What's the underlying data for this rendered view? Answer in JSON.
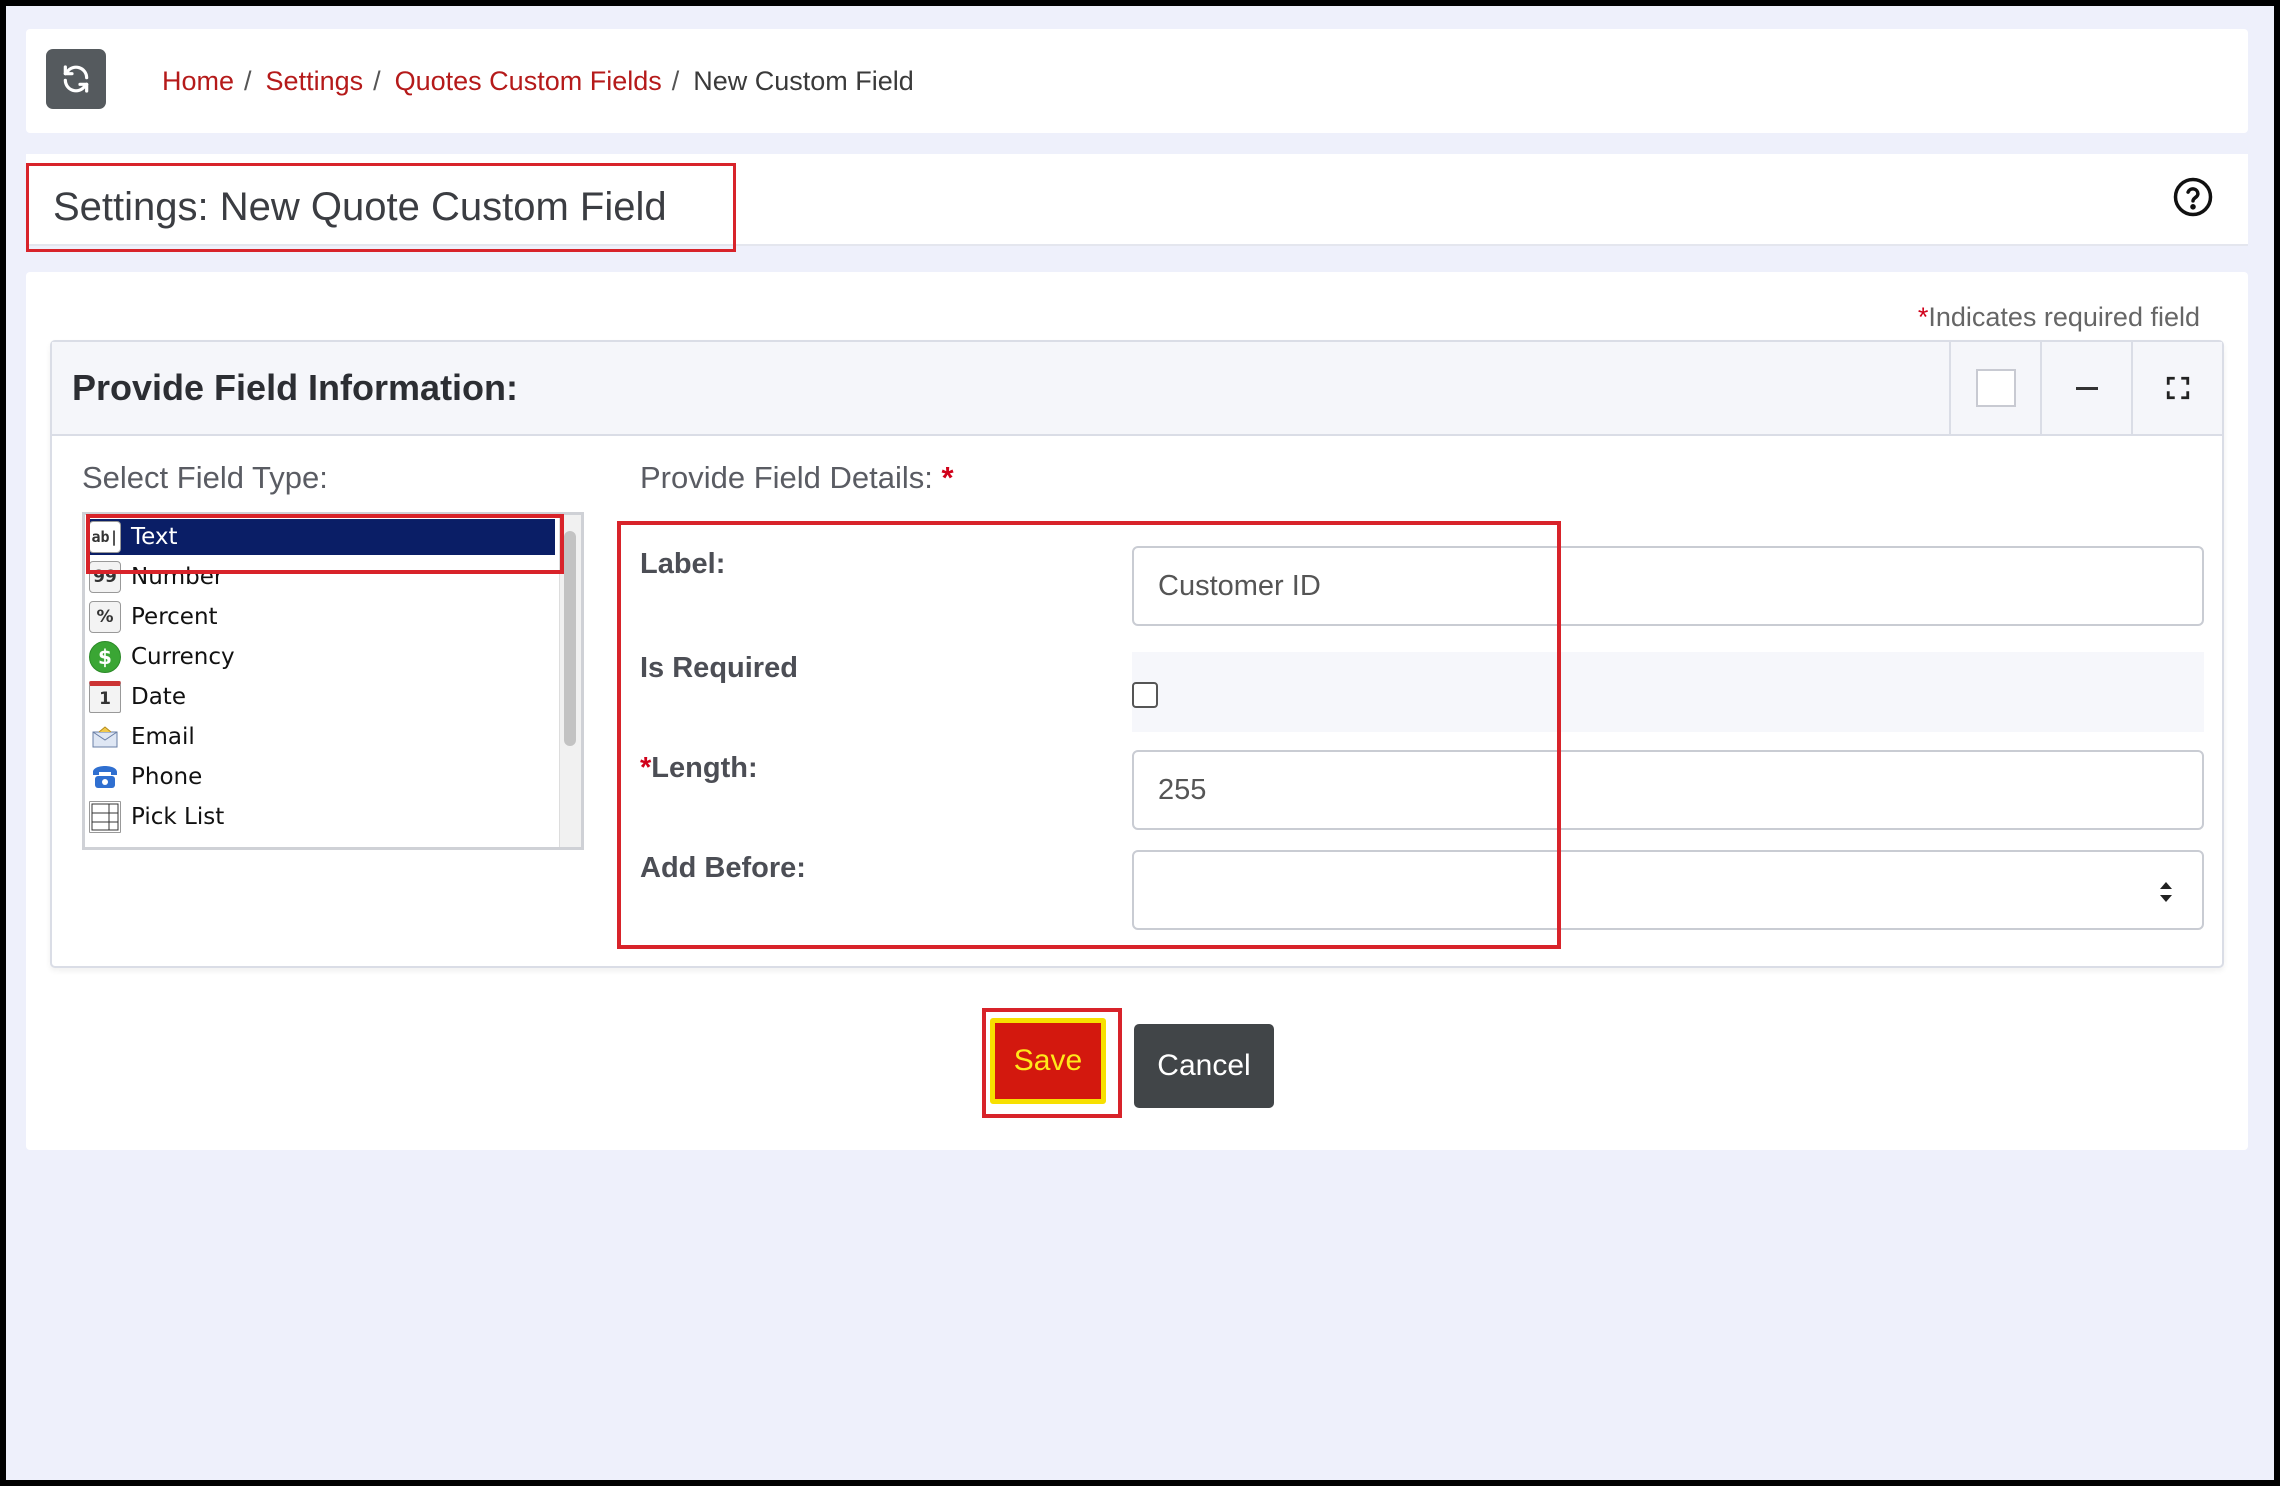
{
  "breadcrumb": {
    "refresh_icon": "refresh-icon",
    "items": [
      "Home",
      "Settings",
      "Quotes Custom Fields"
    ],
    "separator": "/",
    "current": "New Custom Field"
  },
  "header": {
    "title": "Settings: New Quote Custom Field",
    "help_icon": "question-circle-icon"
  },
  "required_note": {
    "star": "*",
    "text": "Indicates required field"
  },
  "panel": {
    "title": "Provide Field Information:",
    "tools": [
      "checkbox-square-icon",
      "minimize-icon",
      "expand-icon"
    ]
  },
  "field_type": {
    "label": "Select Field Type:",
    "options": [
      {
        "label": "Text",
        "icon": "ab|",
        "selected": true
      },
      {
        "label": "Number",
        "icon": "99"
      },
      {
        "label": "Percent",
        "icon": "%"
      },
      {
        "label": "Currency",
        "icon": "$"
      },
      {
        "label": "Date",
        "icon": "1"
      },
      {
        "label": "Email",
        "icon": "envelope"
      },
      {
        "label": "Phone",
        "icon": "phone"
      },
      {
        "label": "Pick List",
        "icon": "list"
      }
    ]
  },
  "details": {
    "label": "Provide Field Details:",
    "star": "*",
    "fields": {
      "label_field": {
        "label": "Label:",
        "value": "Customer ID"
      },
      "is_required": {
        "label": "Is Required",
        "checked": false
      },
      "length": {
        "star": "*",
        "label": "Length:",
        "value": "255"
      },
      "add_before": {
        "label": "Add Before:",
        "value": ""
      }
    }
  },
  "actions": {
    "save": "Save",
    "cancel": "Cancel"
  },
  "colors": {
    "link": "#b51a1a",
    "highlight": "#d8232a",
    "save_bg": "#d3180e",
    "save_text": "#ffe81a",
    "cancel_bg": "#414548",
    "selected_item": "#0a1e66",
    "page_bg": "#eef0fb"
  }
}
